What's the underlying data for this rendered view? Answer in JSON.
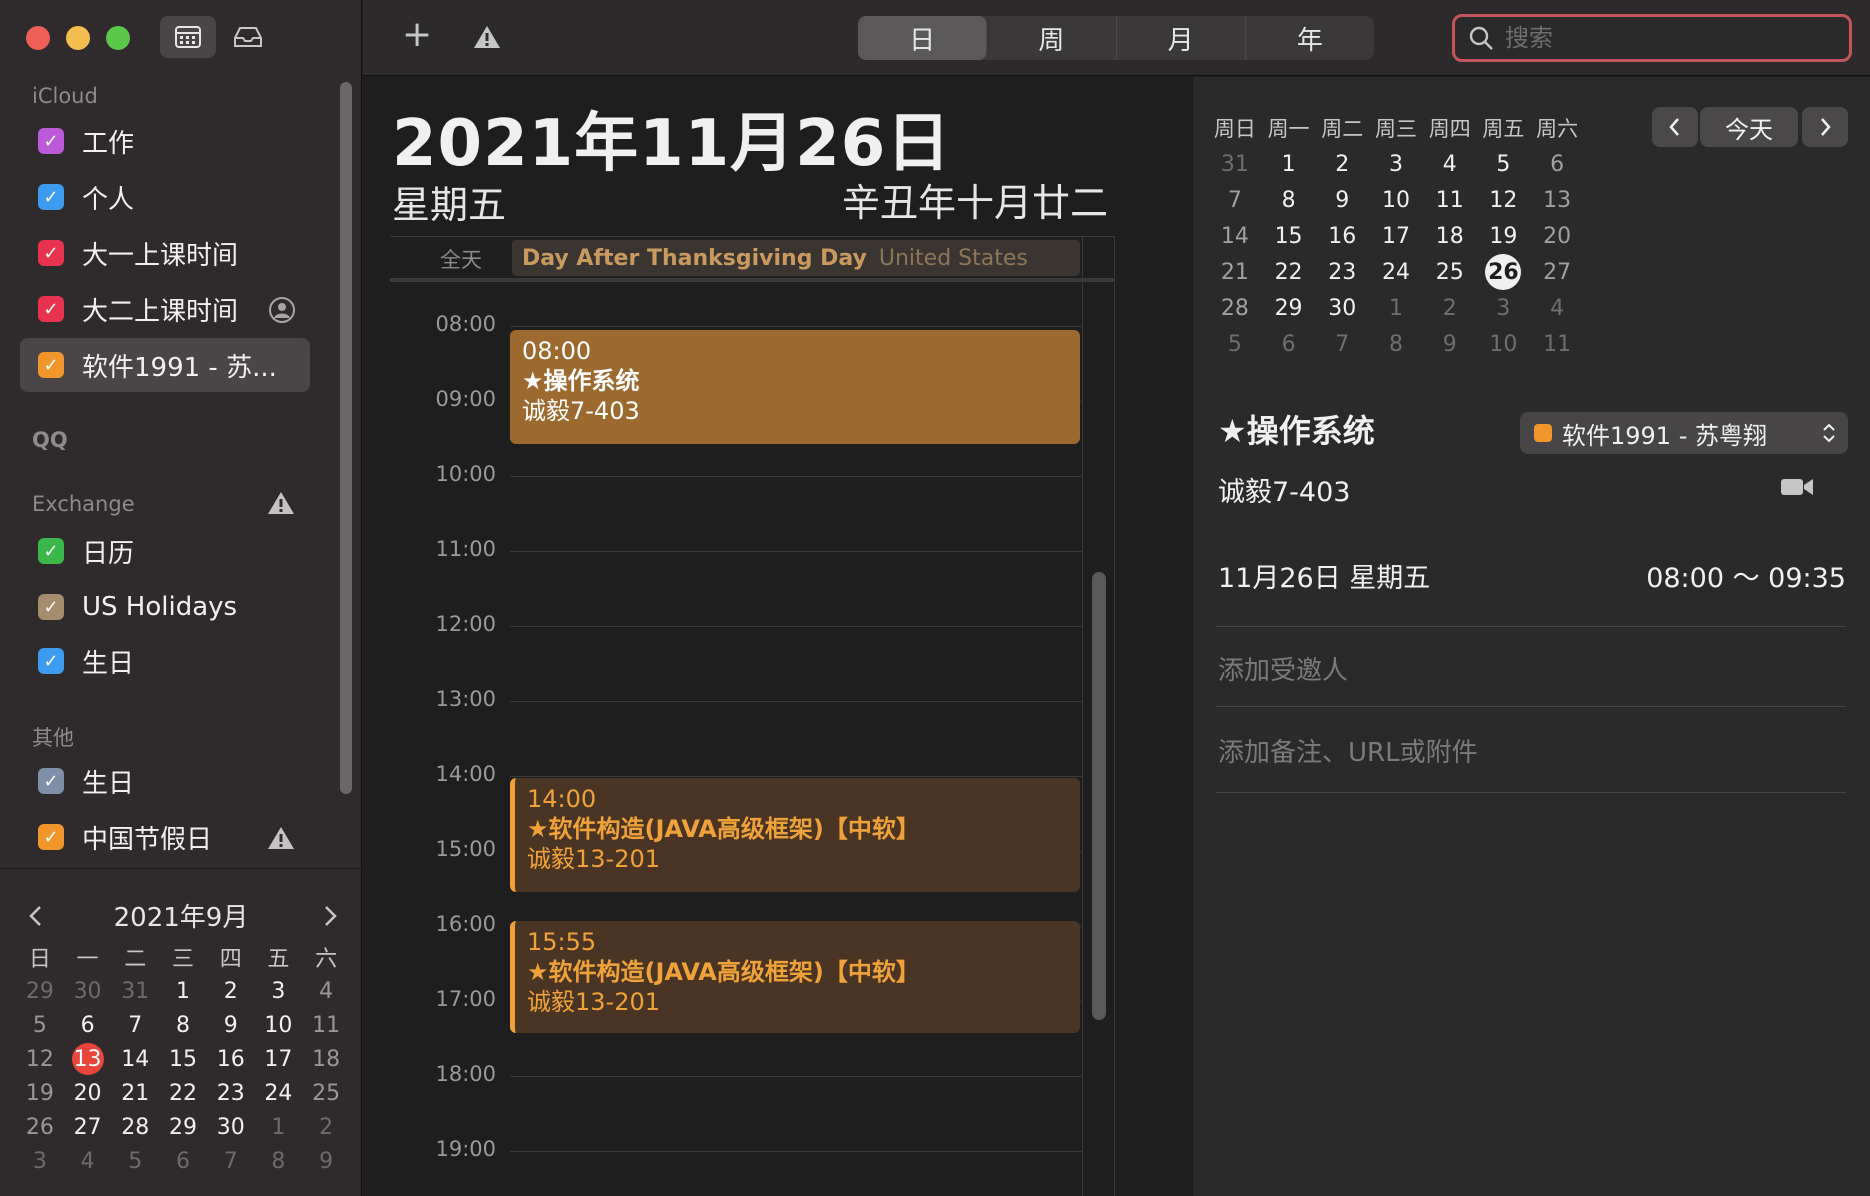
{
  "colors": {
    "accent_red": "#e8453c",
    "event_primary": "#9c6a2e",
    "event_secondary": "#4a3524",
    "event_text_orange": "#f0a23a",
    "search_ring": "#c2545a"
  },
  "sidebar": {
    "icloud_header": "iCloud",
    "icloud_items": [
      {
        "label": "工作",
        "color": "#bd5ad8"
      },
      {
        "label": "个人",
        "color": "#3d9bf0"
      },
      {
        "label": "大一上课时间",
        "color": "#e8334f"
      },
      {
        "label": "大二上课时间",
        "color": "#e8334f"
      },
      {
        "label": "软件1991 - 苏...",
        "color": "#f0962a"
      }
    ],
    "qq_header": "QQ",
    "exchange_header": "Exchange",
    "exchange_items": [
      {
        "label": "日历",
        "color": "#3bb84a"
      },
      {
        "label": "US Holidays",
        "color": "#a48c6c"
      },
      {
        "label": "生日",
        "color": "#3d9bf0"
      }
    ],
    "other_header": "其他",
    "other_items": [
      {
        "label": "生日",
        "color": "#7f8fa8"
      },
      {
        "label": "中国节假日",
        "color": "#f0962a"
      }
    ]
  },
  "mini_calendar": {
    "title": "2021年9月",
    "weekdays": [
      "日",
      "一",
      "二",
      "三",
      "四",
      "五",
      "六"
    ],
    "days": [
      "29",
      "30",
      "31",
      "1",
      "2",
      "3",
      "4",
      "5",
      "6",
      "7",
      "8",
      "9",
      "10",
      "11",
      "12",
      "13",
      "14",
      "15",
      "16",
      "17",
      "18",
      "19",
      "20",
      "21",
      "22",
      "23",
      "24",
      "25",
      "26",
      "27",
      "28",
      "29",
      "30",
      "1",
      "2",
      "3",
      "4",
      "5",
      "6",
      "7",
      "8",
      "9"
    ],
    "today": "13"
  },
  "toolbar": {
    "add_label": "+",
    "views": [
      "日",
      "周",
      "月",
      "年"
    ],
    "active_view": "日",
    "search_placeholder": "搜索"
  },
  "day_view": {
    "date_title": "2021年11月26日",
    "weekday": "星期五",
    "lunar": "辛丑年十月廿二",
    "allday_label": "全天",
    "allday_event": {
      "title": "Day After Thanksgiving Day",
      "location": "United States"
    },
    "hours": [
      "08:00",
      "09:00",
      "10:00",
      "11:00",
      "12:00",
      "13:00",
      "14:00",
      "15:00",
      "16:00",
      "17:00",
      "18:00",
      "19:00"
    ],
    "events": [
      {
        "time": "08:00",
        "title": "★操作系统",
        "location": "诚毅7-403"
      },
      {
        "time": "14:00",
        "title": "★软件构造(JAVA高级框架)【中软】",
        "location": "诚毅13-201"
      },
      {
        "time": "15:55",
        "title": "★软件构造(JAVA高级框架)【中软】",
        "location": "诚毅13-201"
      }
    ]
  },
  "right_calendar": {
    "weekdays": [
      "周日",
      "周一",
      "周二",
      "周三",
      "周四",
      "周五",
      "周六"
    ],
    "days": [
      "31",
      "1",
      "2",
      "3",
      "4",
      "5",
      "6",
      "7",
      "8",
      "9",
      "10",
      "11",
      "12",
      "13",
      "14",
      "15",
      "16",
      "17",
      "18",
      "19",
      "20",
      "21",
      "22",
      "23",
      "24",
      "25",
      "26",
      "27",
      "28",
      "29",
      "30",
      "1",
      "2",
      "3",
      "4",
      "5",
      "6",
      "7",
      "8",
      "9",
      "10",
      "11"
    ],
    "selected": "26",
    "today_button": "今天"
  },
  "inspector": {
    "title": "★操作系统",
    "calendar": "软件1991 - 苏粤翔",
    "location": "诚毅7-403",
    "date": "11月26日 星期五",
    "time": "08:00 ～ 09:35",
    "add_invitees": "添加受邀人",
    "add_notes": "添加备注、URL或附件"
  }
}
